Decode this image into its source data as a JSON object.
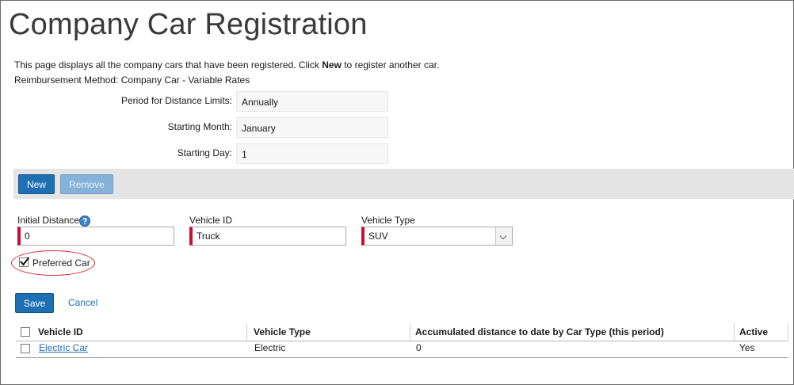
{
  "page": {
    "title": "Company Car Registration",
    "intro_before": "This page displays all the company cars that have been registered. Click ",
    "intro_bold": "New",
    "intro_after": " to register another car.",
    "reimbursement_method": "Reimbursement Method: Company Car - Variable Rates"
  },
  "settings": [
    {
      "label": "Period for Distance Limits:",
      "value": "Annually"
    },
    {
      "label": "Starting Month:",
      "value": "January"
    },
    {
      "label": "Starting Day:",
      "value": "1"
    }
  ],
  "toolbar": {
    "new_label": "New",
    "remove_label": "Remove"
  },
  "form": {
    "initial_distance_label": "Initial Distance",
    "initial_distance_value": "0",
    "vehicle_id_label": "Vehicle ID",
    "vehicle_id_value": "Truck",
    "vehicle_type_label": "Vehicle Type",
    "vehicle_type_value": "SUV",
    "preferred_car_label": "Preferred Car",
    "preferred_car_checked": true,
    "save_label": "Save",
    "cancel_label": "Cancel"
  },
  "table": {
    "headers": [
      "Vehicle ID",
      "Vehicle Type",
      "Accumulated distance to date by Car Type (this period)",
      "Active"
    ],
    "rows": [
      {
        "vehicle_id": "Electric Car",
        "vehicle_type": "Electric",
        "accumulated": "0",
        "active": "Yes"
      }
    ]
  },
  "icons": {
    "help": "help-question-icon",
    "checkmark": "checkmark-icon",
    "dropdown": "chevron-down-icon"
  },
  "colors": {
    "primary": "#1f6fb5",
    "required": "#c8102e",
    "highlight_circle": "#d6262b",
    "toolbar_bg": "#e4e4e4"
  }
}
